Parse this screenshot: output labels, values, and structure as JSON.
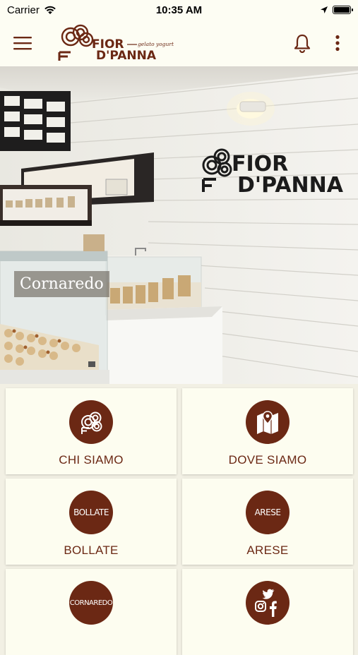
{
  "status_bar": {
    "carrier": "Carrier",
    "time": "10:35 AM"
  },
  "app_bar": {
    "logo_text_top": "FIOR",
    "logo_text_bottom": "D'PANNA",
    "logo_tagline": "gelato yogurt"
  },
  "hero": {
    "caption": "Cornaredo",
    "wall_logo_top": "FIOR",
    "wall_logo_bottom": "D'PANNA"
  },
  "tiles": [
    {
      "label": "CHI SIAMO",
      "icon": "logo-swirl-icon"
    },
    {
      "label": "DOVE SIAMO",
      "icon": "map-icon"
    },
    {
      "label": "BOLLATE",
      "circle_text": "BOLLATE"
    },
    {
      "label": "ARESE",
      "circle_text": "ARESE"
    },
    {
      "label": "",
      "circle_text": "CORNAREDO"
    },
    {
      "label": "",
      "icon": "social-icons"
    }
  ],
  "colors": {
    "brand_brown": "#6b2814",
    "tile_bg": "#fdfdf0",
    "bar_bg": "#fdfdf3"
  }
}
